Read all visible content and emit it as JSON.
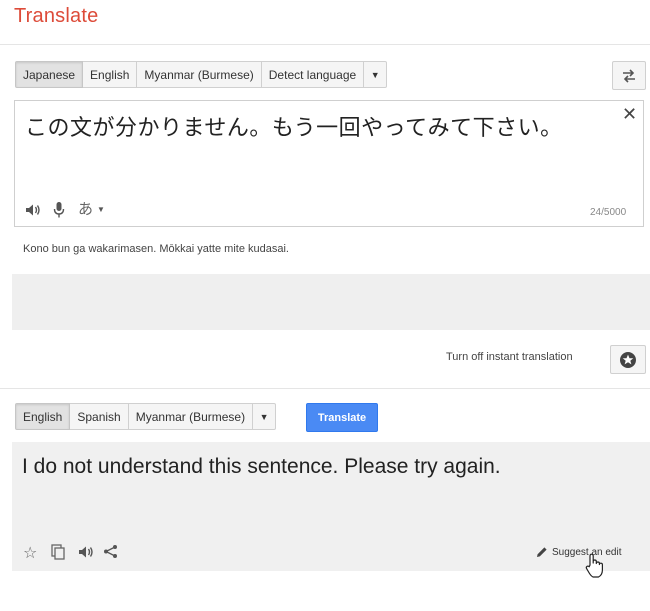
{
  "app": {
    "title": "Translate"
  },
  "source": {
    "languages": [
      "Japanese",
      "English",
      "Myanmar (Burmese)",
      "Detect language"
    ],
    "active_language": "Japanese",
    "text": "この文が分かりません。もう一回やってみて下さい。",
    "ime_label": "あ",
    "char_count": "24/5000",
    "romanization": "Kono bun ga wakarimasen. Mōkkai yatte mite kudasai."
  },
  "options": {
    "instant_label": "Turn off instant translation"
  },
  "target": {
    "languages": [
      "English",
      "Spanish",
      "Myanmar (Burmese)"
    ],
    "active_language": "English",
    "translate_label": "Translate",
    "text": "I do not understand this sentence. Please try again.",
    "suggest_label": "Suggest an edit"
  },
  "icons": {
    "swap": "swap-languages-icon",
    "close": "clear-text-icon",
    "listen": "speaker-icon",
    "mic": "microphone-icon",
    "star": "star-icon",
    "copy": "copy-icon",
    "share": "share-icon",
    "pencil": "pencil-icon",
    "phrasebook": "phrasebook-star-icon"
  },
  "colors": {
    "brand": "#dd4b39",
    "primary_button": "#4a8af4"
  }
}
